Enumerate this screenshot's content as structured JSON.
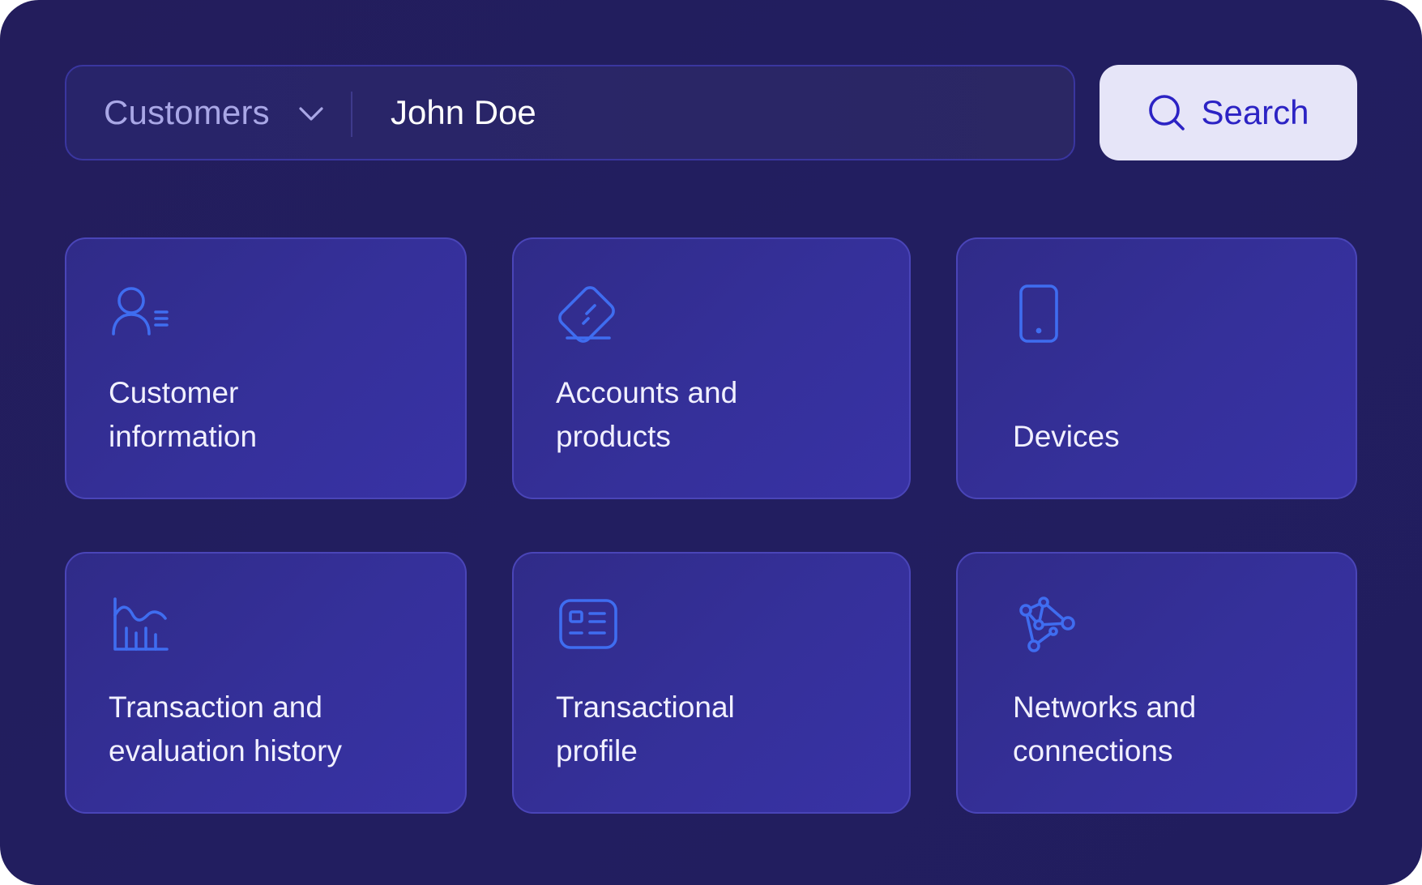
{
  "search": {
    "scope_label": "Customers",
    "query_value": "John Doe",
    "button_label": "Search"
  },
  "cards": [
    {
      "line1": "Customer",
      "line2": "information",
      "icon": "customer-list-icon"
    },
    {
      "line1": "Accounts and",
      "line2": "products",
      "icon": "card-icon"
    },
    {
      "line1": "",
      "line2": "Devices",
      "icon": "phone-icon"
    },
    {
      "line1": "Transaction and",
      "line2": "evaluation history",
      "icon": "chart-icon"
    },
    {
      "line1": "Transactional",
      "line2": "profile",
      "icon": "id-card-icon"
    },
    {
      "line1": "Networks and",
      "line2": "connections",
      "icon": "network-icon"
    }
  ],
  "colors": {
    "accent": "#3f6df0",
    "panel_bg": "#221e60",
    "card_bg": "#35309a",
    "button_bg": "#e6e5f8",
    "button_text": "#2c23c4"
  }
}
